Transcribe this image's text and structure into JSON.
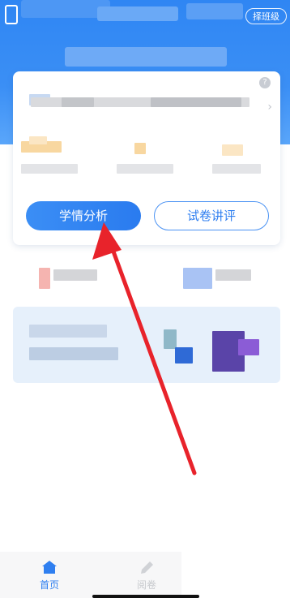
{
  "header": {
    "class_select_label": "择班级"
  },
  "card": {
    "help_icon": "?",
    "chevron": "›",
    "primary_button": "学情分析",
    "secondary_button": "试卷讲评"
  },
  "tabbar": {
    "items": [
      {
        "label": "首页",
        "icon": "home-icon",
        "active": true
      },
      {
        "label": "阅卷",
        "icon": "pen-icon",
        "active": false
      }
    ]
  },
  "colors": {
    "accent": "#2f7ff0",
    "header": "#3b8ff5",
    "annotation_arrow": "#e8232b"
  }
}
